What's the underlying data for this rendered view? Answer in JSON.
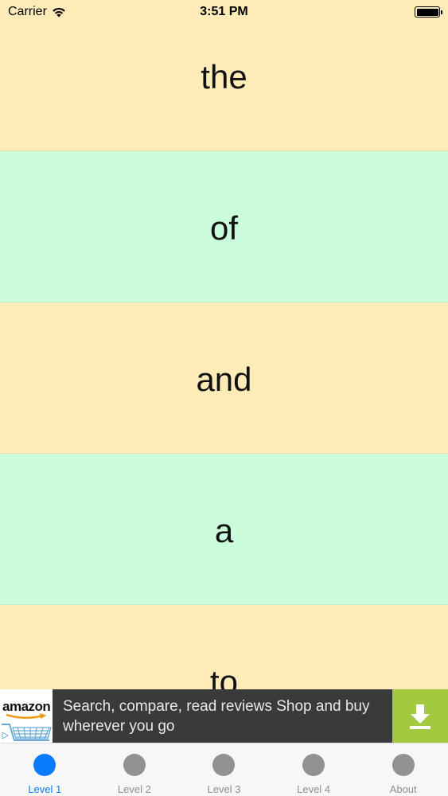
{
  "status_bar": {
    "carrier": "Carrier",
    "time": "3:51 PM"
  },
  "words": [
    {
      "text": "the",
      "color": "#feecb8"
    },
    {
      "text": "of",
      "color": "#c9fddc"
    },
    {
      "text": "and",
      "color": "#feecb8"
    },
    {
      "text": "a",
      "color": "#c9fddc"
    },
    {
      "text": "to",
      "color": "#feecb8"
    }
  ],
  "ad": {
    "logo_text": "amazon",
    "text": "Search, compare, read reviews Shop and buy wherever you go",
    "download_icon": "download-icon",
    "accent_color": "#a3c940"
  },
  "tabs": [
    {
      "label": "Level 1",
      "active": true
    },
    {
      "label": "Level 2",
      "active": false
    },
    {
      "label": "Level 3",
      "active": false
    },
    {
      "label": "Level 4",
      "active": false
    },
    {
      "label": "About",
      "active": false
    }
  ],
  "colors": {
    "active_tab": "#0a7aff",
    "inactive_tab": "#929292"
  }
}
